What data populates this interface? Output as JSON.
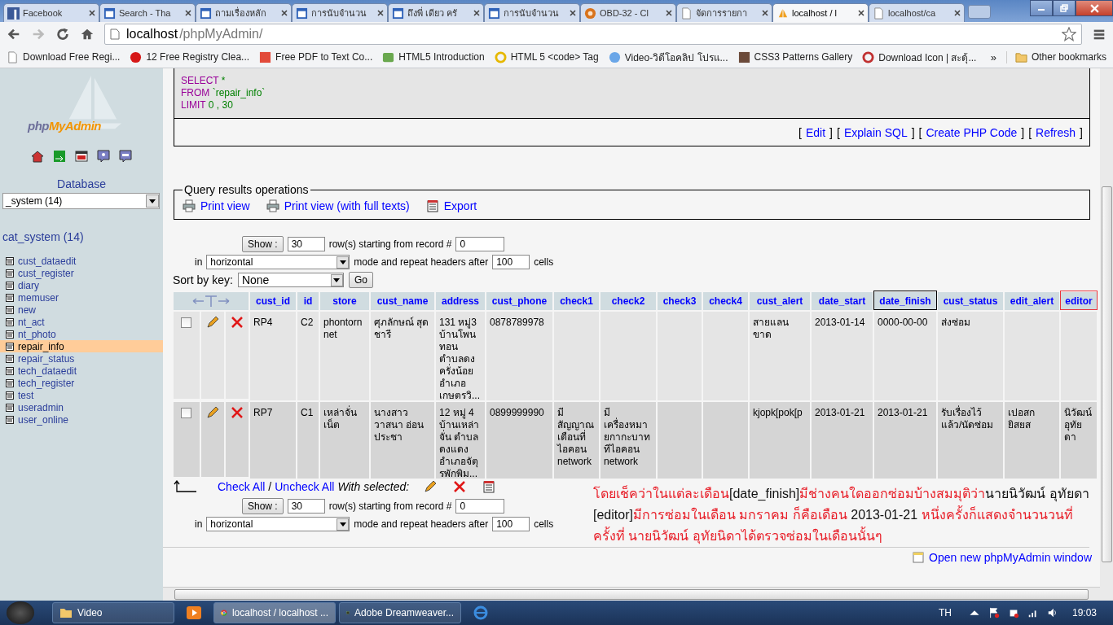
{
  "browser": {
    "tabs": [
      {
        "title": "Facebook",
        "selected": false
      },
      {
        "title": "Search - Tha",
        "selected": false
      },
      {
        "title": "ถามเรื่องหลัก",
        "selected": false
      },
      {
        "title": "การนับจำนวน",
        "selected": false
      },
      {
        "title": "ถึงพี่ เดียว ครั",
        "selected": false
      },
      {
        "title": "การนับจำนวน",
        "selected": false
      },
      {
        "title": "OBD-32 - Cl",
        "selected": false
      },
      {
        "title": "จัดการรายกา",
        "selected": false
      },
      {
        "title": "localhost / l",
        "selected": true
      },
      {
        "title": "localhost/ca",
        "selected": false
      }
    ],
    "url_host": "localhost",
    "url_path": "/phpMyAdmin/",
    "bookmarks": [
      {
        "label": "Download Free Regi..."
      },
      {
        "label": "12 Free Registry Clea..."
      },
      {
        "label": "Free PDF to Text Co..."
      },
      {
        "label": "HTML5 Introduction"
      },
      {
        "label": "HTML 5 <code> Tag"
      },
      {
        "label": "Video-วิดีโอคลิป โปรแ..."
      },
      {
        "label": "CSS3 Patterns Gallery"
      },
      {
        "label": "Download Icon | สะดุ้..."
      }
    ],
    "more": "»",
    "other_bookmarks": "Other bookmarks"
  },
  "sidebar": {
    "logo_a": "php",
    "logo_b": "MyAdmin",
    "database_label": "Database",
    "database_value": "_system (14)",
    "db_title": "cat_system (14)",
    "tables": [
      {
        "name": "cust_dataedit",
        "selected": false
      },
      {
        "name": "cust_register",
        "selected": false
      },
      {
        "name": "diary",
        "selected": false
      },
      {
        "name": "memuser",
        "selected": false
      },
      {
        "name": "new",
        "selected": false
      },
      {
        "name": "nt_act",
        "selected": false
      },
      {
        "name": "nt_photo",
        "selected": false
      },
      {
        "name": "repair_info",
        "selected": true
      },
      {
        "name": "repair_status",
        "selected": false
      },
      {
        "name": "tech_dataedit",
        "selected": false
      },
      {
        "name": "tech_register",
        "selected": false
      },
      {
        "name": "test",
        "selected": false
      },
      {
        "name": "useradmin",
        "selected": false
      },
      {
        "name": "user_online",
        "selected": false
      }
    ]
  },
  "sql": {
    "lines": [
      {
        "keyword": "SELECT",
        "rest": " *"
      },
      {
        "keyword": "FROM",
        "rest": " `repair_info`"
      },
      {
        "keyword": "LIMIT",
        "rest": " 0 , 30"
      }
    ],
    "links": [
      {
        "open": "[",
        "label": "Edit",
        "close": "]"
      },
      {
        "open": "[",
        "label": "Explain SQL",
        "close": "]"
      },
      {
        "open": "[",
        "label": "Create PHP Code",
        "close": "]"
      },
      {
        "open": "[",
        "label": "Refresh",
        "close": "]"
      }
    ]
  },
  "operations": {
    "legend": "Query results operations",
    "items": [
      {
        "label": "Print view",
        "kind": "print"
      },
      {
        "label": "Print view (with full texts)",
        "kind": "print"
      },
      {
        "label": "Export",
        "kind": "export"
      }
    ]
  },
  "nav_top": {
    "show": "Show :",
    "rows": "30",
    "rows_text": "row(s) starting from record #",
    "start": "0",
    "in": "in",
    "mode": "horizontal",
    "mode_text": "mode and repeat headers after",
    "repeat": "100",
    "cells": "cells"
  },
  "sort": {
    "label": "Sort by key:",
    "value": "None",
    "go": "Go"
  },
  "table": {
    "columns": [
      {
        "label": "cust_id"
      },
      {
        "label": "id"
      },
      {
        "label": "store"
      },
      {
        "label": "cust_name"
      },
      {
        "label": "address"
      },
      {
        "label": "cust_phone"
      },
      {
        "label": "check1"
      },
      {
        "label": "check2"
      },
      {
        "label": "check3"
      },
      {
        "label": "check4"
      },
      {
        "label": "cust_alert"
      },
      {
        "label": "date_start"
      },
      {
        "label": "date_finish",
        "color": "#000000"
      },
      {
        "label": "cust_status"
      },
      {
        "label": "edit_alert"
      },
      {
        "label": "editor",
        "color": "#e8343c"
      }
    ],
    "rows": [
      {
        "checked": false,
        "cells": [
          "RP4",
          "C2",
          "phontorn net",
          "ศุภลักษณ์  สุดชารี",
          "131 หมู่3 บ้านโพนทอน ตำบลดงครั่งน้อย อำเภอเกษตรวิ...",
          "0878789978",
          null,
          null,
          null,
          null,
          "สายแลนขาด",
          "2013-01-14",
          "0000-00-00",
          "ส่งซ่อม",
          null,
          null
        ]
      },
      {
        "checked": false,
        "cells": [
          "RP7",
          "C1",
          "เหล่าจั่นเน็ต",
          "นางสาว วาสนา อ่อนประชา",
          "12 หมู่ 4 บ้านเหล่าจั่น ตำบลดงแดง อำเภอจัตุรพักพิม...",
          "0899999990",
          "มีสัญญาณเตือนที่ไอคอน network",
          "มีเครื่องหมายกากะบาททีไอคอน network",
          null,
          null,
          "kjopk[pok[p",
          "2013-01-21",
          "2013-01-21",
          "รับเรื่องไว้แล้ว/นัดซ่อม",
          "เปอสกยิสยส",
          "นิวัฒน์  อุทัยดา"
        ]
      }
    ]
  },
  "with_selected": {
    "check_all": "Check All",
    "sep": "/",
    "uncheck_all": "Uncheck All",
    "label": "With selected:"
  },
  "nav_bottom": {
    "show": "Show :",
    "rows": "30",
    "rows_text": "row(s) starting from record #",
    "start": "0",
    "in": "in",
    "mode": "horizontal",
    "mode_text": "mode and repeat headers after",
    "repeat": "100",
    "cells": "cells"
  },
  "note": [
    {
      "text": "โดยเช็คว่าในแต่ละเดือน",
      "color": "#e8202a"
    },
    {
      "text": "[date_finish]",
      "color": "#111111"
    },
    {
      "text": "มีช่างคนใดออกซ่อมบ้างสมมุติว่า",
      "color": "#e8202a"
    },
    {
      "text": "นายนิวัฒน์ อุทัยดา [editor]",
      "color": "#111111"
    },
    {
      "text": "มีการซ่อมในเดือน มกราคม ก็คือเดือน ",
      "color": "#e8202a"
    },
    {
      "text": "2013-01-21",
      "color": "#111111"
    },
    {
      "text": " หนึ่งครั้งก็แสดงจำนวนวนที่ครั้งที่ นายนิวัฒน์   อุทัยนิดาได้ตรวจซ่อมในเดือนนั้นๆ",
      "color": "#e8202a"
    }
  ],
  "open_window": "Open new phpMyAdmin window",
  "taskbar": {
    "items": [
      {
        "label": "Video",
        "selected": false
      },
      {
        "selected": false
      },
      {
        "label": "localhost / localhost ...",
        "selected": true
      },
      {
        "label": "Adobe Dreamweaver...",
        "selected": false
      },
      {
        "selected": false
      }
    ],
    "lang": "TH",
    "clock": "19:03"
  }
}
